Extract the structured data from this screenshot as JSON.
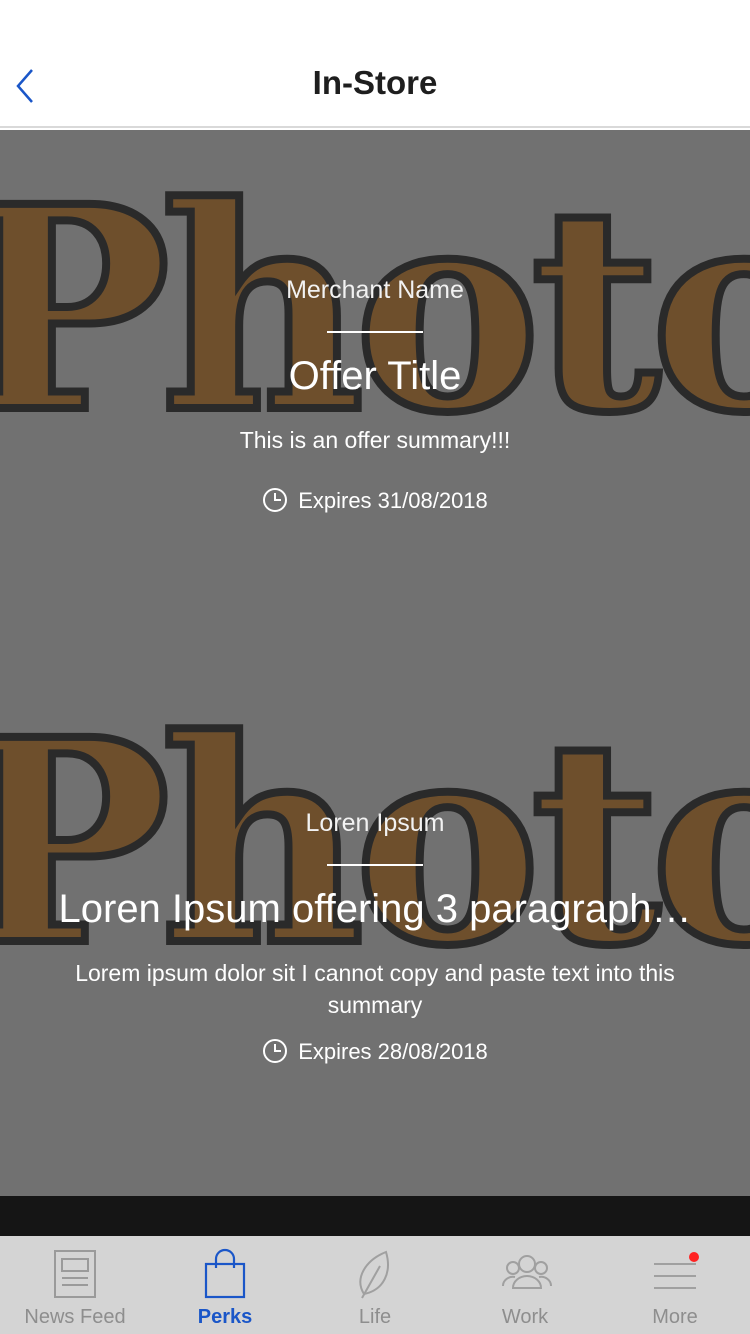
{
  "header": {
    "title": "In-Store"
  },
  "offers": [
    {
      "merchant": "Merchant Name",
      "title": "Offer Title",
      "summary": "This is an offer summary!!!",
      "expires": "Expires 31/08/2018"
    },
    {
      "merchant": "Loren Ipsum",
      "title": "Loren Ipsum offering 3 paragraph…",
      "summary": "Lorem ipsum dolor sit  I cannot copy and paste text into this summary",
      "expires": "Expires 28/08/2018"
    }
  ],
  "tabs": [
    {
      "label": "News Feed",
      "icon": "news-icon",
      "active": false
    },
    {
      "label": "Perks",
      "icon": "bag-icon",
      "active": true
    },
    {
      "label": "Life",
      "icon": "leaf-icon",
      "active": false
    },
    {
      "label": "Work",
      "icon": "people-icon",
      "active": false
    },
    {
      "label": "More",
      "icon": "menu-icon",
      "active": false
    }
  ],
  "colors": {
    "accent": "#1a56c8",
    "badge": "#ff2222",
    "card_overlay": "#717171"
  }
}
